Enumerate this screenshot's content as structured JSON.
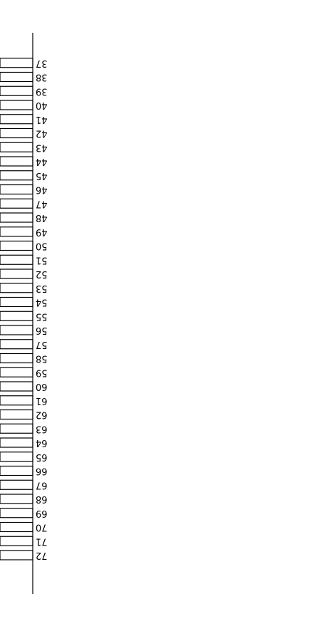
{
  "chart_data": {
    "type": "bar",
    "orientation": "horizontal",
    "rendering": "rotated-180",
    "categories": [
      "37",
      "38",
      "39",
      "40",
      "41",
      "42",
      "43",
      "44",
      "45",
      "46",
      "47",
      "48",
      "49",
      "50",
      "51",
      "52",
      "53",
      "54",
      "55",
      "56",
      "57",
      "58",
      "59",
      "60",
      "61",
      "62",
      "63",
      "64",
      "65",
      "66",
      "67",
      "68",
      "69",
      "70",
      "71",
      "72"
    ],
    "series": [
      {
        "values": [
          1,
          1,
          1,
          1,
          1,
          1,
          1,
          1,
          1,
          1,
          1,
          1,
          1,
          1,
          1,
          1,
          1,
          1,
          1,
          1,
          1,
          1,
          1,
          1,
          1,
          1,
          1,
          1,
          1,
          1,
          1,
          1,
          1,
          1,
          1,
          1
        ]
      }
    ],
    "title": "",
    "xlabel": "",
    "ylabel": "",
    "grid": false,
    "legend": "none",
    "colors": {
      "bar_fill": "#ffffff",
      "bar_stroke": "#000000",
      "axis": "#000000",
      "text": "#000000"
    }
  }
}
